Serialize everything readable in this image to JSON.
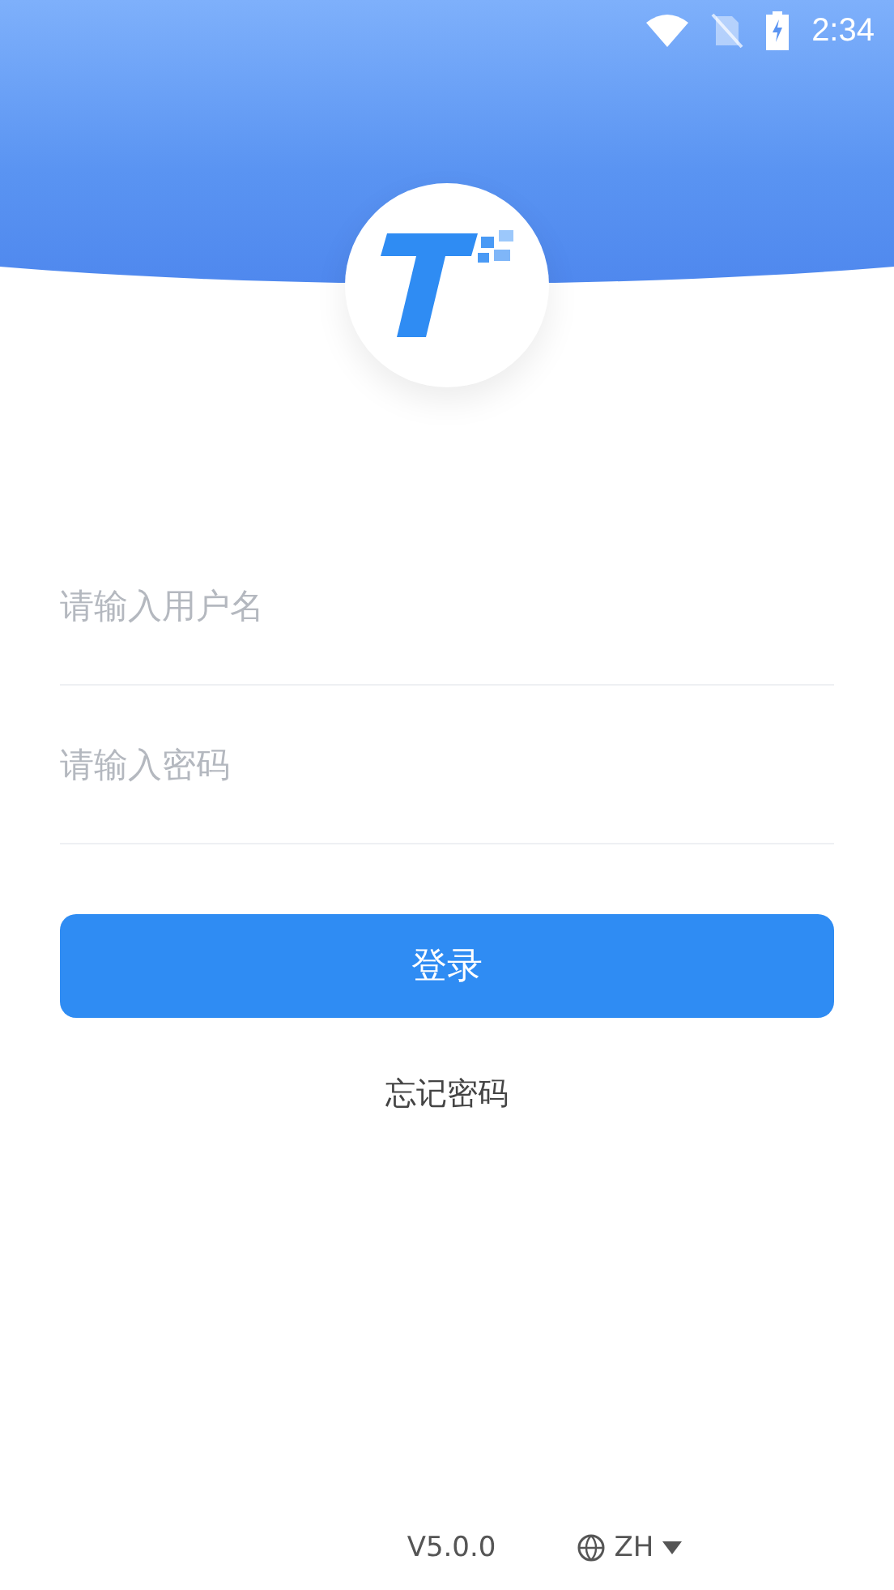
{
  "status_bar": {
    "time": "2:34"
  },
  "form": {
    "fields": [
      {
        "placeholder": "请输入用户名"
      },
      {
        "placeholder": "请输入密码"
      }
    ],
    "login_button": "登录",
    "forgot_password": "忘记密码"
  },
  "footer": {
    "version": "V5.0.0",
    "language": "ZH"
  }
}
